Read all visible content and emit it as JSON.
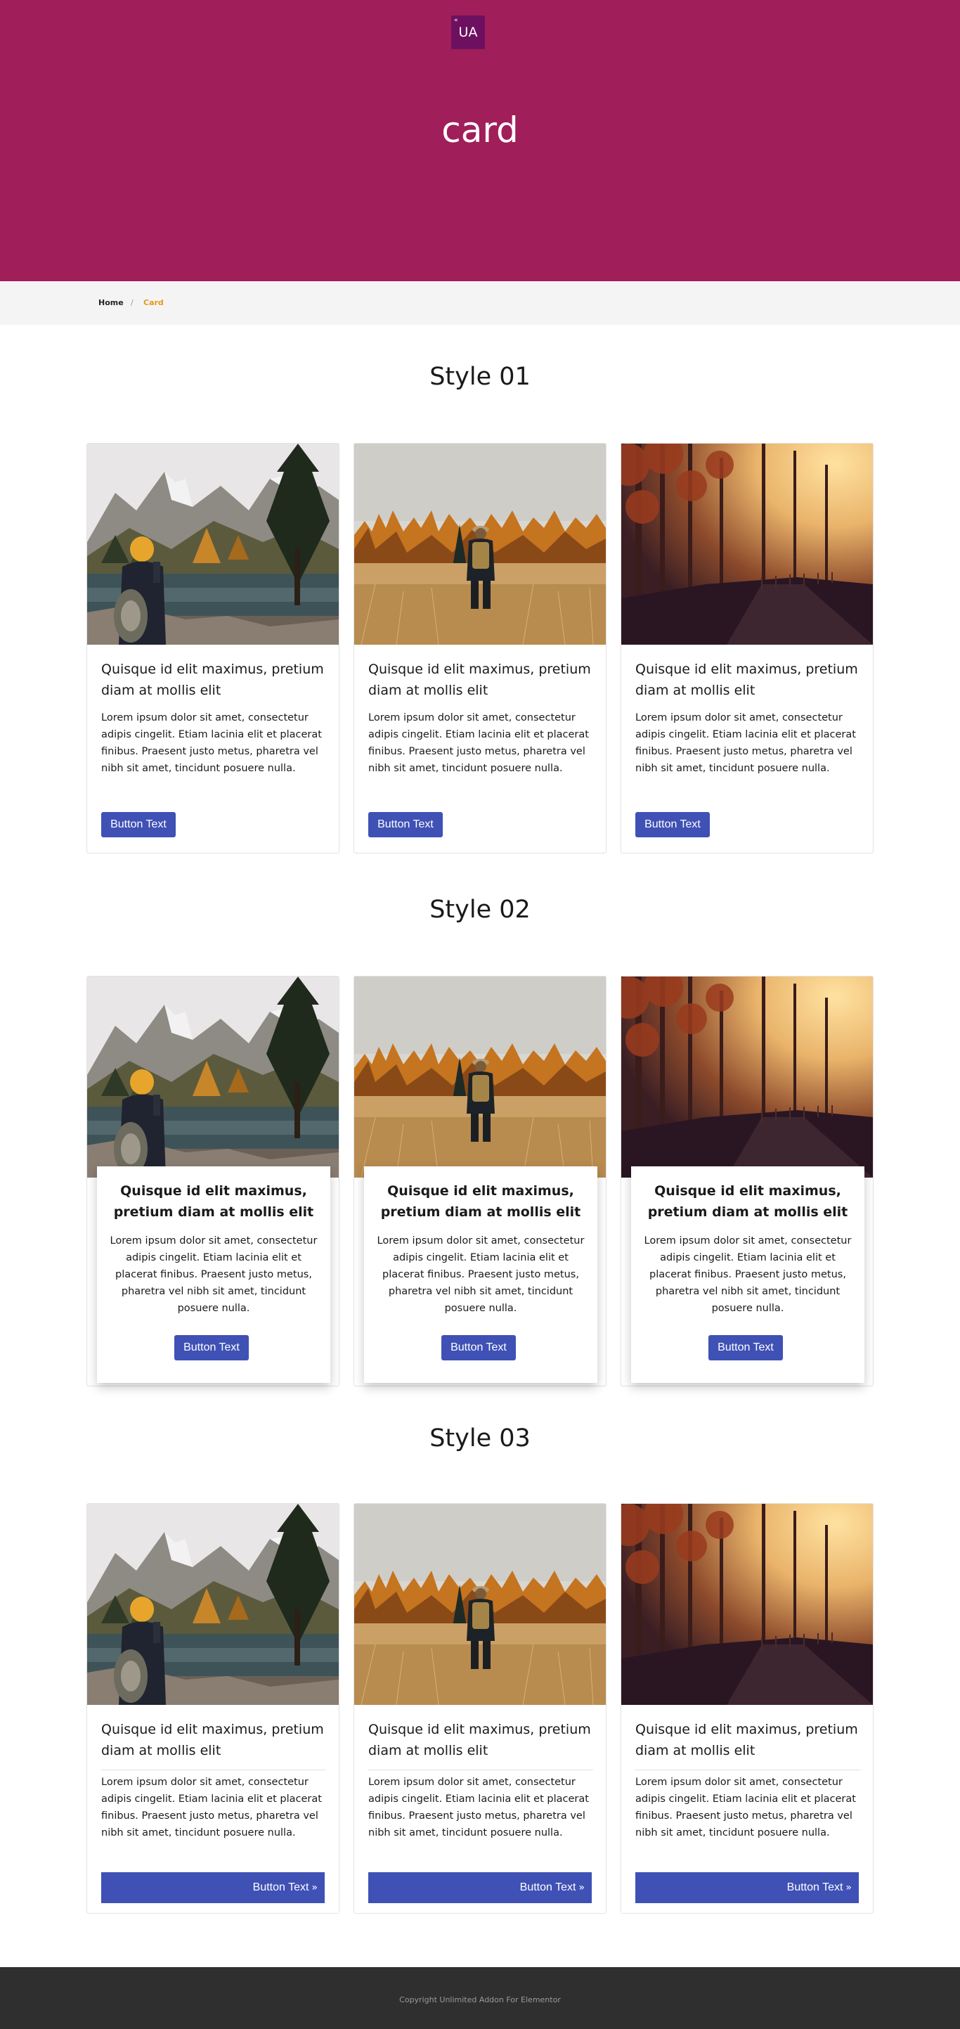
{
  "header": {
    "logo_mark": "«",
    "logo_text": "UA",
    "title": "card",
    "background": "#a01e59"
  },
  "breadcrumb": {
    "home": "Home",
    "separator": "/",
    "current": "Card"
  },
  "sections": [
    {
      "title": "Style 01"
    },
    {
      "title": "Style 02"
    },
    {
      "title": "Style 03"
    }
  ],
  "card": {
    "title": "Quisque id elit maximus, pretium diam at mollis elit",
    "text": "Lorem ipsum dolor sit amet, consectetur adipis cingelit. Etiam lacinia elit et placerat finibus. Praesent justo metus, pharetra vel nibh sit amet, tincidunt posuere nulla.",
    "button": "Button Text",
    "button_arrow": "»",
    "images": [
      "mountain-lake-hiker-image",
      "autumn-field-hiker-image",
      "autumn-forest-sunset-image"
    ]
  },
  "colors": {
    "accent": "#3f51b5",
    "breadcrumb_current": "#e39a1e",
    "footer": "#2f2f2f"
  },
  "footer": {
    "text": "Copyright Unlimited Addon For Elementor"
  }
}
